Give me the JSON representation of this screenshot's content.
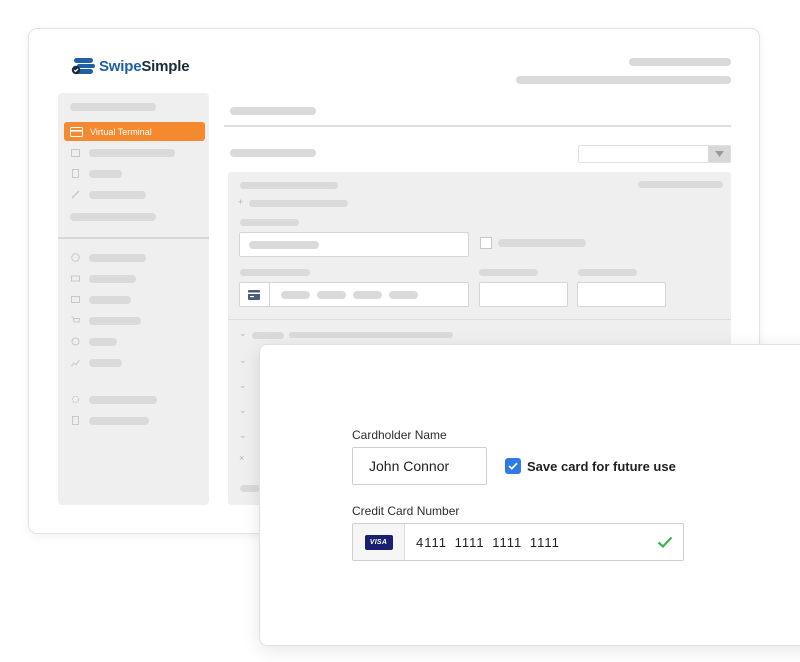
{
  "app": {
    "logo_swipe": "Swipe",
    "logo_simple": "Simple",
    "brand_color": "#1f5fa8"
  },
  "sidebar": {
    "active_item": "Virtual Terminal",
    "active_color": "#f4892f",
    "active_icon": "credit-card-icon",
    "icons": [
      "calendar-icon",
      "document-icon",
      "link-icon",
      "dashboard-icon",
      "cash-icon",
      "card-icon",
      "cart-icon",
      "badge-icon",
      "chart-icon",
      "settings-icon",
      "report-icon"
    ]
  },
  "payment_form": {
    "cardholder_label": "Cardholder Name",
    "cardholder_value": "John Connor",
    "save_card_label": "Save card for future use",
    "save_card_checked": true,
    "card_number_label": "Credit Card Number",
    "card_brand": "VISA",
    "card_number": "4111 1111 1111 1111",
    "valid_icon": "check-icon",
    "checkbox_color": "#2f7ae5",
    "valid_color": "#3cb54a"
  }
}
